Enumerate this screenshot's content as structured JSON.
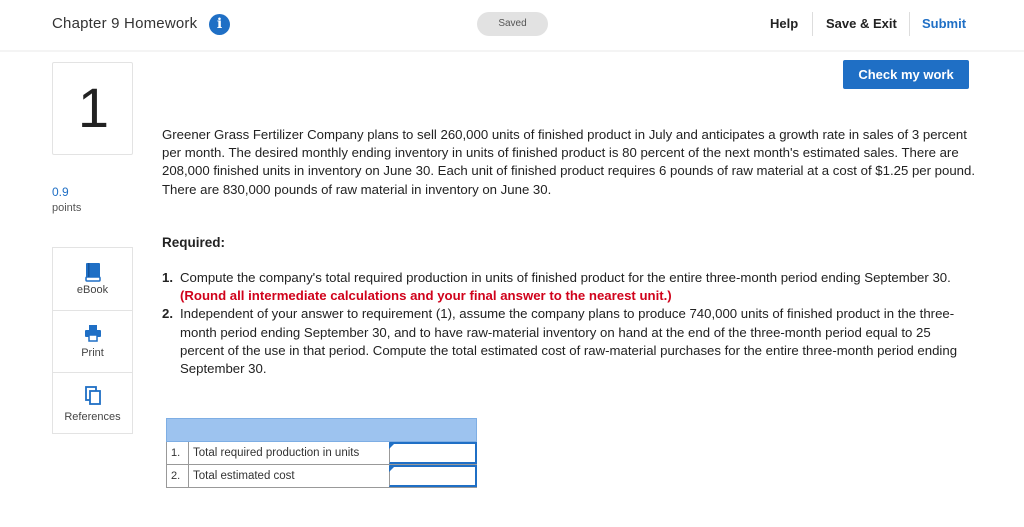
{
  "header": {
    "title": "Chapter 9 Homework",
    "saved_label": "Saved",
    "help_label": "Help",
    "save_exit_label": "Save & Exit",
    "submit_label": "Submit"
  },
  "question": {
    "number": "1",
    "points_value": "0.9",
    "points_label": "points"
  },
  "tools": [
    {
      "label": "eBook",
      "icon": "book-icon"
    },
    {
      "label": "Print",
      "icon": "printer-icon"
    },
    {
      "label": "References",
      "icon": "references-icon"
    }
  ],
  "check_button": "Check my work",
  "problem_text": "Greener Grass Fertilizer Company plans to sell 260,000 units of finished product in July and anticipates a growth rate in sales of 3 percent per month. The desired monthly ending inventory in units of finished product is 80 percent of the next month's estimated sales. There are 208,000 finished units in inventory on June 30. Each unit of finished product requires 6 pounds of raw material at a cost of $1.25 per pound. There are 830,000 pounds of raw material in inventory on June 30.",
  "required_label": "Required:",
  "requirements": [
    {
      "num": "1.",
      "text": "Compute the company's total required production in units of finished product for the entire three-month period ending September 30.",
      "note": "(Round all intermediate calculations and your final answer to the nearest unit.)"
    },
    {
      "num": "2.",
      "text": "Independent of your answer to requirement (1), assume the company plans to produce 740,000 units of finished product in the three-month period ending September 30, and to have raw-material inventory on hand at the end of the three-month period equal to 25 percent of the use in that period. Compute the total estimated cost of raw-material purchases for the entire three-month period ending September 30.",
      "note": ""
    }
  ],
  "answer_table": {
    "rows": [
      {
        "num": "1.",
        "label": "Total required production in units",
        "value": ""
      },
      {
        "num": "2.",
        "label": "Total estimated cost",
        "value": ""
      }
    ]
  },
  "colors": {
    "accent": "#1f6fc5",
    "highlight_red": "#d0021b",
    "table_header": "#9dc3ef"
  }
}
